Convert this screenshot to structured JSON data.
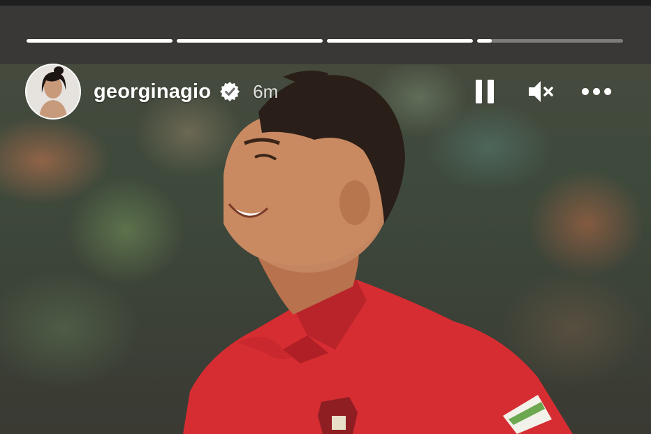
{
  "story": {
    "username": "georginagio",
    "verified": true,
    "time_ago": "6m",
    "progress": [
      1,
      1,
      1,
      0.1
    ]
  },
  "controls": {
    "pause_icon": "pause-icon",
    "mute_icon": "speaker-muted-icon",
    "more_icon": "more-options-icon"
  },
  "colors": {
    "top_bar": "#3a3837",
    "jersey": "#d62d32",
    "progress_active": "#ffffff"
  }
}
